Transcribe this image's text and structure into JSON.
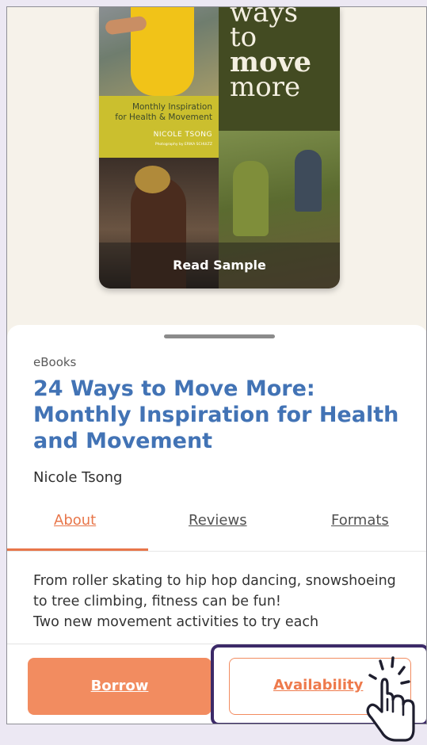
{
  "cover": {
    "title_line1": "ways",
    "title_line2": "to",
    "title_line3": "move",
    "title_line4": "more",
    "subtitle_line1": "Monthly Inspiration",
    "subtitle_line2": "for Health & Movement",
    "author": "NICOLE TSONG",
    "photographer": "Photography by ERIKA SCHULTZ",
    "read_sample_label": "Read Sample"
  },
  "book": {
    "category": "eBooks",
    "title": "24 Ways to Move More: Monthly Inspiration for Health and Movement",
    "author": "Nicole Tsong"
  },
  "tabs": [
    {
      "label": "About",
      "active": true
    },
    {
      "label": "Reviews",
      "active": false
    },
    {
      "label": "Formats",
      "active": false
    }
  ],
  "description": {
    "line1": "From roller skating to hip hop dancing, snowshoeing to tree climbing, fitness can be fun!",
    "line2": "Two new movement activities to try each"
  },
  "actions": {
    "borrow_label": "Borrow",
    "availability_label": "Availability"
  },
  "colors": {
    "accent": "#f28c60",
    "title_blue": "#4273b5",
    "highlight": "#3c2a68"
  }
}
